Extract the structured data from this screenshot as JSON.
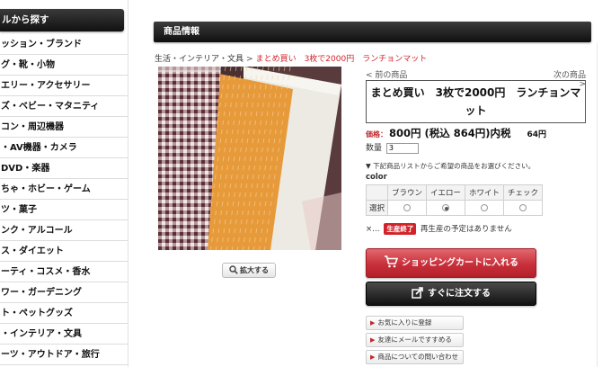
{
  "sidebar": {
    "header": "ルから探す",
    "items": [
      {
        "label": "ッション・ブランド"
      },
      {
        "label": "グ・靴・小物"
      },
      {
        "label": "エリー・アクセサリー"
      },
      {
        "label": "ズ・ベビー・マタニティ"
      },
      {
        "label": "コン・周辺機器"
      },
      {
        "label": "・AV機器・カメラ"
      },
      {
        "label": "DVD・楽器"
      },
      {
        "label": "ちゃ・ホビー・ゲーム"
      },
      {
        "label": "ツ・菓子"
      },
      {
        "label": "ンク・アルコール"
      },
      {
        "label": "ス・ダイエット"
      },
      {
        "label": "ーティ・コスメ・香水"
      },
      {
        "label": "ワー・ガーデニング"
      },
      {
        "label": "ト・ペットグッズ"
      },
      {
        "label": "・インテリア・文具"
      },
      {
        "label": "ーツ・アウトドア・旅行"
      }
    ]
  },
  "section": {
    "title": "商品情報"
  },
  "breadcrumb": {
    "parent": "生活・インテリア・文具",
    "separator": ">",
    "current": "まとめ買い　3枚で2000円　ランチョンマット"
  },
  "product": {
    "zoom_label": "拡大する",
    "prev": "< 前の商品",
    "next": "次の商品 >",
    "title": "まとめ買い　3枚で2000円　ランチョンマット",
    "price_label": "価格：",
    "price": "800円 (税込 864円)内税",
    "tax": "64円",
    "qty_label": "数量",
    "qty_value": "3",
    "note": "▼ 下記商品リストからご希望の商品をお選びください。",
    "color_label": "color",
    "variants": {
      "row_label": "選択",
      "options": [
        "ブラウン",
        "イエロー",
        "ホワイト",
        "チェック"
      ],
      "selected": "イエロー"
    },
    "stock_prefix": "×…",
    "stock_badge": "生産終了",
    "stock_text": "再生産の予定はありません",
    "cart_button": "ショッピングカートに入れる",
    "order_button": "すぐに注文する",
    "links": [
      "お気に入りに登録",
      "友達にメールですすめる",
      "商品についての問い合わせ"
    ]
  },
  "colors": {
    "accent_red": "#c8303a",
    "header_dark": "#1a1a1a",
    "breadcrumb_current": "#d2232a"
  }
}
